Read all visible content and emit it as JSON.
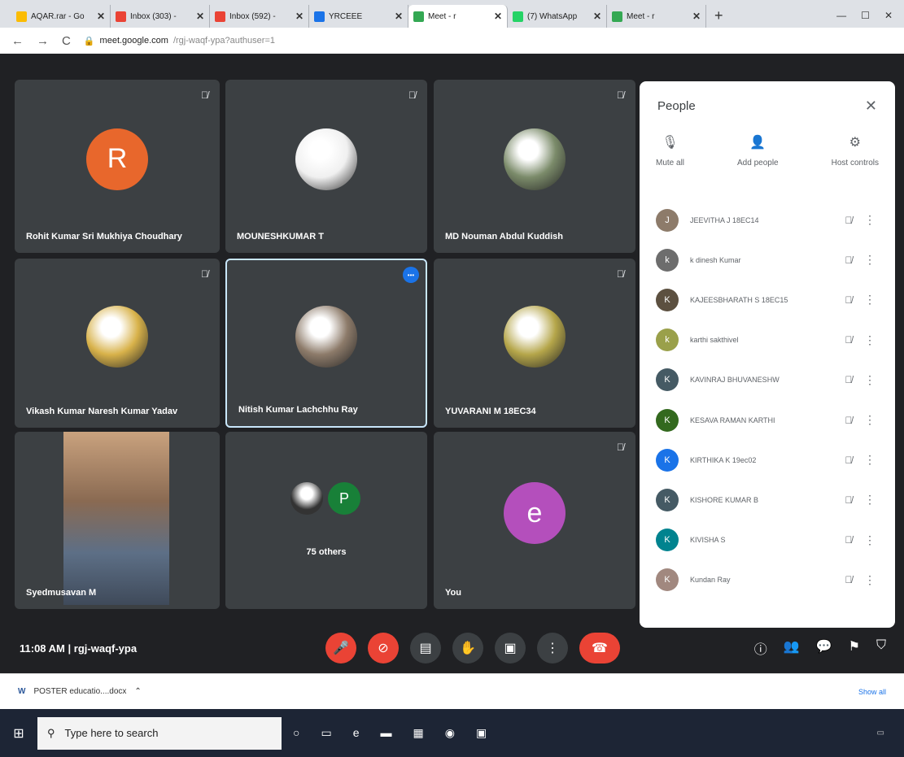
{
  "browser": {
    "tabs": [
      {
        "label": "AQAR.rar - Go",
        "color": "#fbbc04",
        "active": false
      },
      {
        "label": "Inbox (303) -",
        "color": "#ea4335",
        "active": false
      },
      {
        "label": "Inbox (592) -",
        "color": "#ea4335",
        "active": false
      },
      {
        "label": "YRCEEE",
        "color": "#1a73e8",
        "active": false
      },
      {
        "label": "Meet - r",
        "color": "#34a853",
        "active": true
      },
      {
        "label": "(7) WhatsApp",
        "color": "#25d366",
        "active": false
      },
      {
        "label": "Meet - r",
        "color": "#34a853",
        "active": false
      }
    ],
    "url_host": "meet.google.com",
    "url_path": "/rgj-waqf-ypa?authuser=1"
  },
  "tiles": [
    {
      "name": "Rohit Kumar Sri Mukhiya Choudhary",
      "kind": "letter",
      "letter": "R",
      "color": "#e8672c"
    },
    {
      "name": "MOUNESHKUMAR T",
      "kind": "photo",
      "color": "#f0f0f0"
    },
    {
      "name": "MD Nouman Abdul Kuddish",
      "kind": "photo",
      "color": "#7b8b6a"
    },
    {
      "name": "Vikash Kumar Naresh Kumar Yadav",
      "kind": "photo",
      "color": "#d8b24a"
    },
    {
      "name": "Nitish Kumar Lachchhu Ray",
      "kind": "photo",
      "color": "#8d7b6a"
    },
    {
      "name": "YUVARANI M 18EC34",
      "kind": "photo",
      "color": "#b5a64a"
    },
    {
      "name": "Syedmusavan M",
      "kind": "video",
      "color": "#8a8f96"
    },
    {
      "name": "75 others",
      "kind": "group",
      "color": "#188038"
    },
    {
      "name": "You",
      "kind": "letter",
      "letter": "e",
      "color": "#b44fbc"
    }
  ],
  "others_letter": "P",
  "meeting": {
    "time": "11:08 AM",
    "separator": "|",
    "code": "rgj-waqf-ypa"
  },
  "people": {
    "title": "People",
    "actions": [
      {
        "label": "Mute all",
        "icon": "mute-all-icon",
        "glyph": "🎙"
      },
      {
        "label": "Add people",
        "icon": "add-person-icon",
        "glyph": "👤"
      },
      {
        "label": "Host controls",
        "icon": "host-controls-icon",
        "glyph": "⚙"
      }
    ],
    "list": [
      {
        "name": "JEEVITHA J 18EC14",
        "letter": "J",
        "color": "#8d7b6a"
      },
      {
        "name": "k dinesh Kumar",
        "letter": "k",
        "color": "#6d6d6d"
      },
      {
        "name": "KAJEESBHARATH S 18EC15",
        "letter": "K",
        "color": "#5c5040"
      },
      {
        "name": "karthi sakthivel",
        "letter": "k",
        "color": "#9aa04a"
      },
      {
        "name": "KAVINRAJ BHUVANESHW",
        "letter": "K",
        "color": "#455a64"
      },
      {
        "name": "KESAVA RAMAN KARTHI",
        "letter": "K",
        "color": "#33691e"
      },
      {
        "name": "KIRTHIKA K 19ec02",
        "letter": "K",
        "color": "#1a73e8"
      },
      {
        "name": "KISHORE KUMAR B",
        "letter": "K",
        "color": "#455a64"
      },
      {
        "name": "KIVISHA S",
        "letter": "K",
        "color": "#00838f"
      },
      {
        "name": "Kundan Ray",
        "letter": "K",
        "color": "#a1887f"
      }
    ]
  },
  "downloads": {
    "file": "POSTER educatio....docx",
    "show_all": "Show all"
  },
  "taskbar": {
    "search_placeholder": "Type here to search"
  }
}
